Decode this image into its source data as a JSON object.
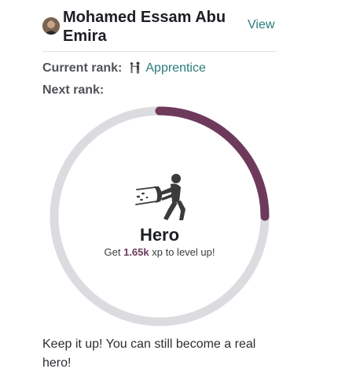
{
  "profile": {
    "name": "Mohamed Essam Abu Emira",
    "view_label": "View"
  },
  "rank": {
    "current_label": "Current rank:",
    "current_value": "Apprentice",
    "next_label": "Next rank:"
  },
  "progress": {
    "next_rank_name": "Hero",
    "get_prefix": "Get",
    "xp_needed": "1.65k",
    "get_suffix": "xp to level up!",
    "fraction": 0.25,
    "track_color": "#dcdbdf",
    "fill_color": "#6e3a5c"
  },
  "footer": {
    "message": "Keep it up! You can still become a real hero!"
  },
  "colors": {
    "link": "#2a7c7a",
    "xp_accent": "#6e3a5c"
  }
}
